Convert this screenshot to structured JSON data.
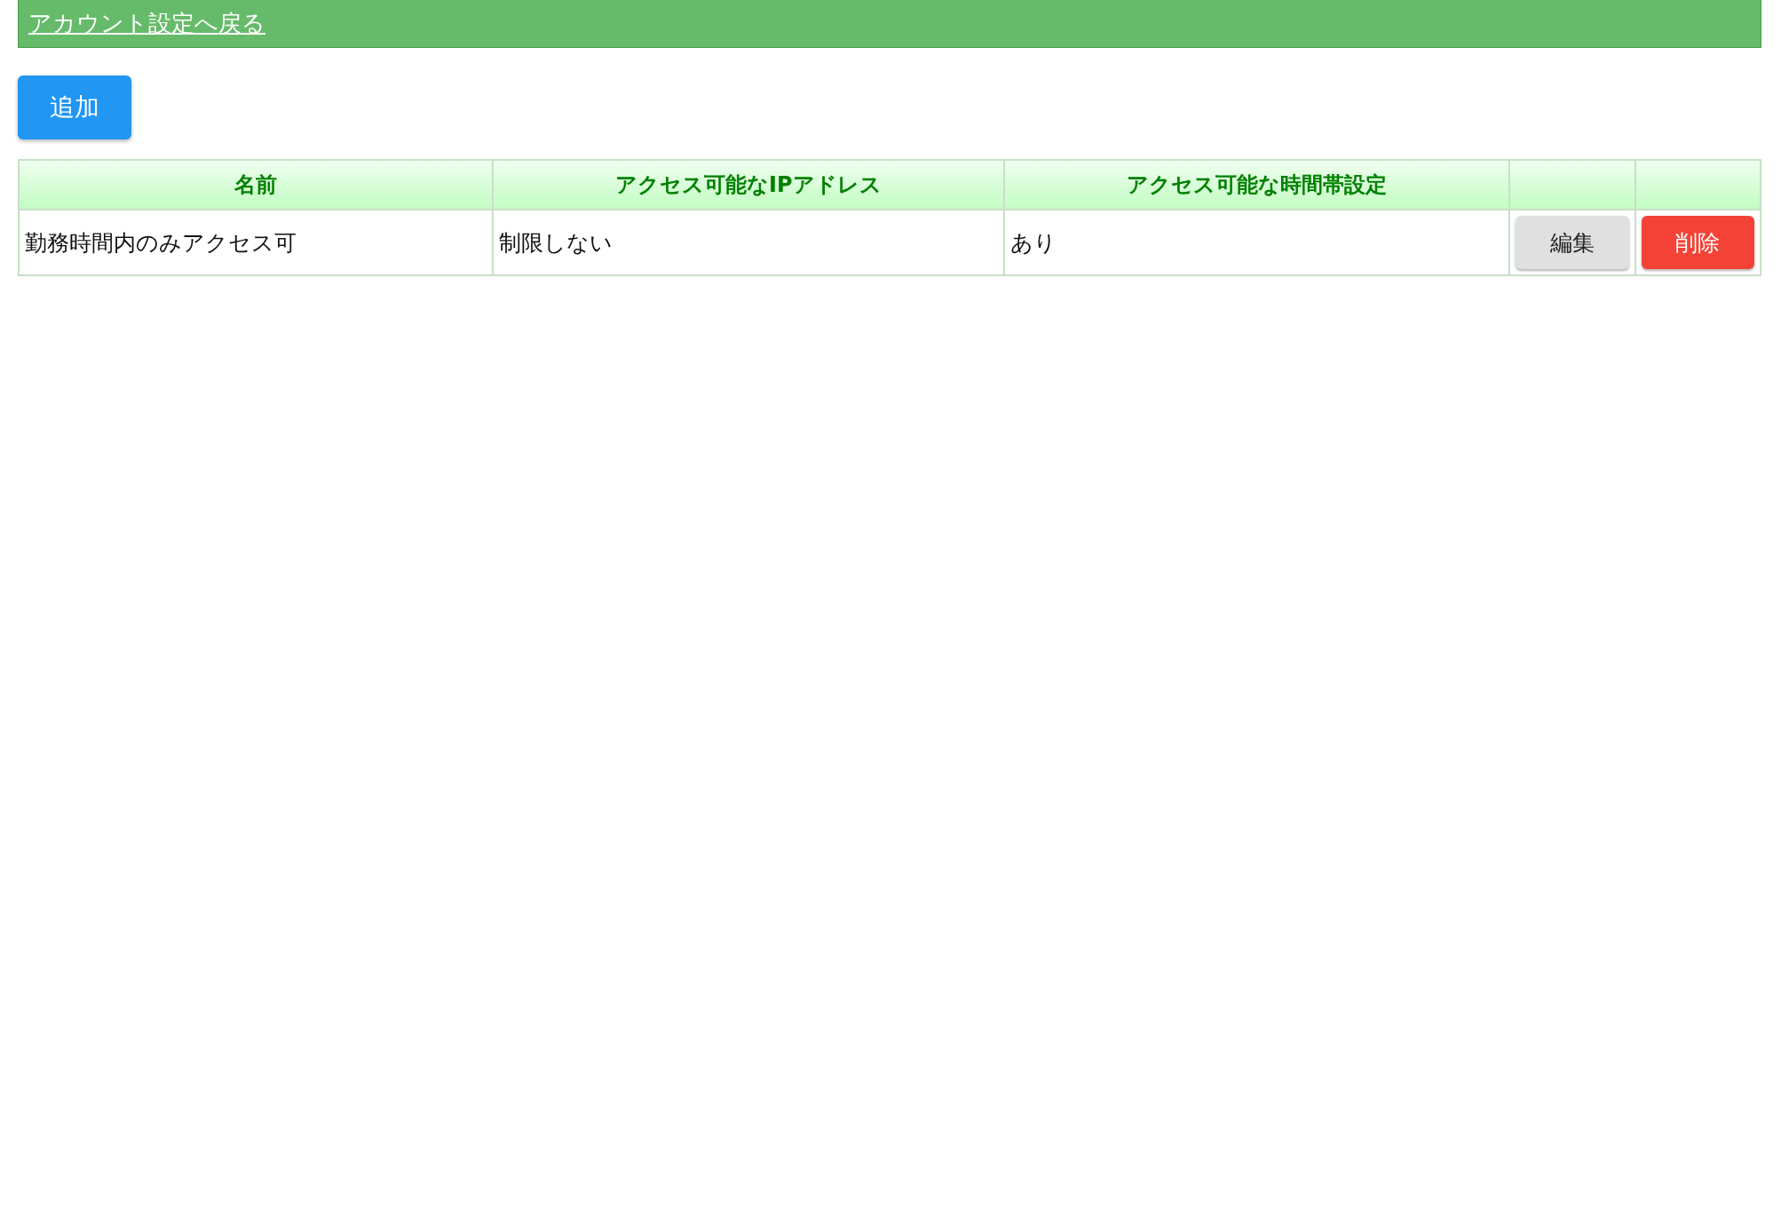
{
  "back_link": "アカウント設定へ戻る",
  "add_button": "追加",
  "table": {
    "columns": [
      "名前",
      "アクセス可能なIPアドレス",
      "アクセス可能な時間帯設定"
    ],
    "rows": [
      {
        "cells": [
          "勤務時間内のみアクセス可",
          "制限しない",
          "あり"
        ],
        "actions": [
          {
            "kind": "edit",
            "label": "編集"
          },
          {
            "kind": "delete",
            "label": "削除"
          }
        ]
      }
    ]
  }
}
